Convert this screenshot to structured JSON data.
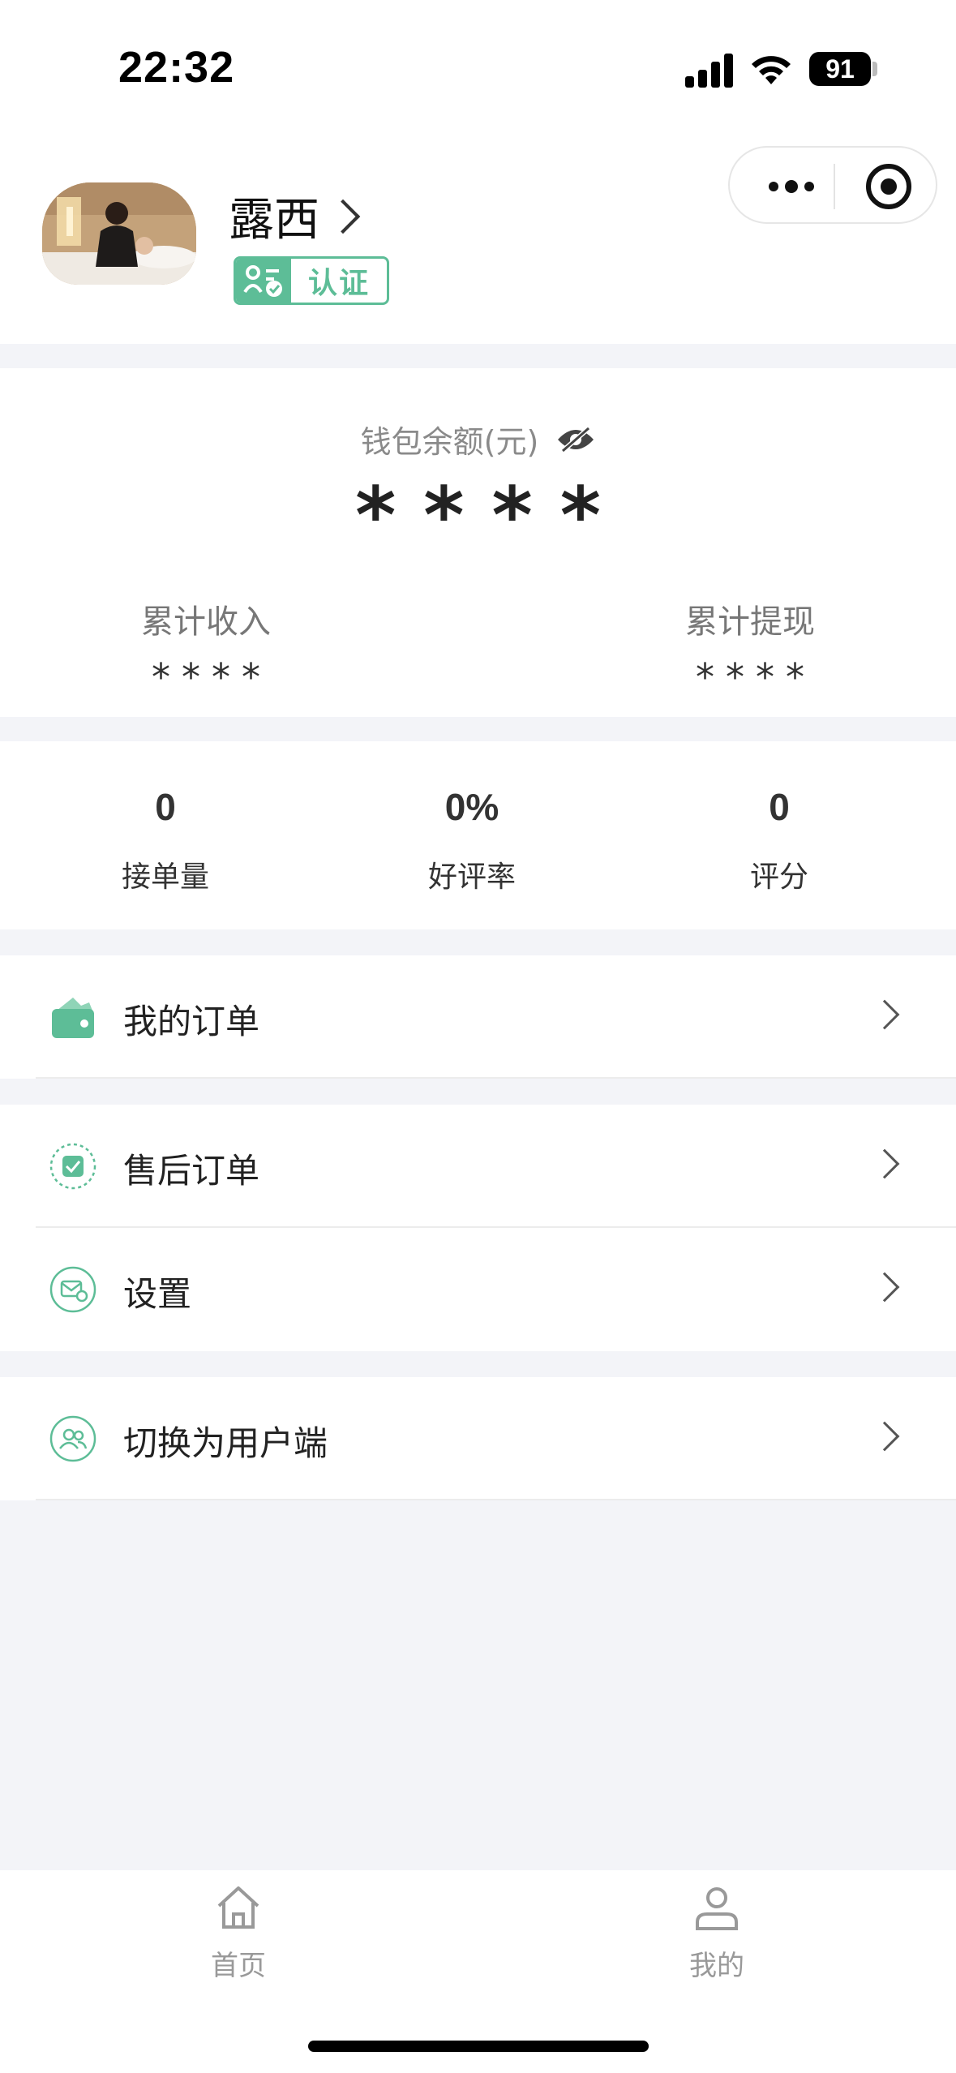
{
  "status_bar": {
    "time": "22:32",
    "battery": "91"
  },
  "profile": {
    "name": "露西",
    "verified_label": "认证"
  },
  "wallet": {
    "balance_label": "钱包余额(元)",
    "balance_value": "****",
    "total_income_label": "累计收入",
    "total_income_value": "****",
    "total_withdraw_label": "累计提现",
    "total_withdraw_value": "****"
  },
  "metrics": [
    {
      "value": "0",
      "label": "接单量"
    },
    {
      "value": "0%",
      "label": "好评率"
    },
    {
      "value": "0",
      "label": "评分"
    }
  ],
  "menu": {
    "my_orders": "我的订单",
    "after_sales": "售后订单",
    "settings": "设置",
    "switch_user": "切换为用户端"
  },
  "tabbar": {
    "home": "首页",
    "mine": "我的"
  },
  "colors": {
    "accent": "#5dbd97",
    "background": "#f3f4f8"
  }
}
